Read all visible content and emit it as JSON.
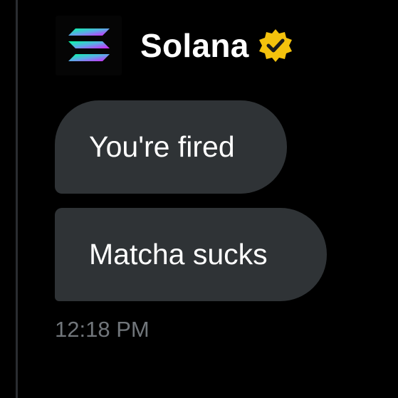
{
  "conversation": {
    "sender": {
      "name": "Solana",
      "avatar_icon": "solana-logo-icon",
      "verified_icon": "verified-badge-icon",
      "verified_color": "#f4c20d"
    },
    "messages": [
      {
        "text": "You're fired"
      },
      {
        "text": "Matcha sucks"
      }
    ],
    "timestamp": "12:18 PM"
  },
  "colors": {
    "background": "#000000",
    "bubble": "#2f3336",
    "text": "#ffffff",
    "muted_text": "#71767b"
  }
}
